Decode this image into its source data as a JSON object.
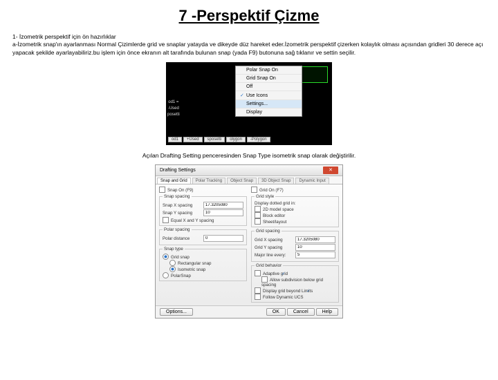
{
  "title": "7 -Perspektif Çizme",
  "para": {
    "line1": "1- İzometrik perspektif için ön hazırlıklar",
    "line2": "a-İzometrik snap'ın ayarlanması Normal Çizimlerde grid ve snaplar yatayda ve dikeyde düz hareket eder.İzometrik perspektif çizerken kolaylık olması açısından gridleri 30 derece açı yapacak şekilde ayarlayabiliriz.bu işlem için önce ekranın alt tarafında bulunan snap (yada F9) butonuna sağ tıklanır ve settin seçilir."
  },
  "ctx_menu": {
    "i0": "Polar Snap On",
    "i1": "Grid Snap On",
    "i2": "Off",
    "i3": "Use Icons",
    "i4": "Settings...",
    "i5": "Display"
  },
  "fig1_tabs": {
    "t0": "od1",
    "t1": "+Used",
    "t2": "sposetti",
    "t3": "olygon",
    "t4": "-Polygon"
  },
  "fig1_side": {
    "s0": "od1 =",
    "s1": "-Used",
    "s2": "posetti"
  },
  "caption": "Açılan Drafting Setting penceresinden Snap Type isometrik snap olarak değiştirilir.",
  "dlg": {
    "title": "Drafting Settings",
    "tabs": {
      "t0": "Snap and Grid",
      "t1": "Polar Tracking",
      "t2": "Object Snap",
      "t3": "3D Object Snap",
      "t4": "Dynamic Input"
    },
    "snap_on": "Snap On (F9)",
    "grid_on": "Grid On (F7)",
    "grp_snap_spacing": "Snap spacing",
    "snap_x": "Snap X spacing",
    "snap_y": "Snap Y spacing",
    "snap_val": "17.3205080",
    "snap_yval": "10",
    "equal_xy": "Equal X and Y spacing",
    "grp_polar": "Polar spacing",
    "polar_d": "Polar distance",
    "polar_v": "0",
    "grp_snaptype": "Snap type",
    "rb_grid": "Grid snap",
    "rb_rect": "Rectangular snap",
    "rb_iso": "Isometric snap",
    "rb_polar": "PolarSnap",
    "grp_gridstyle": "Grid style",
    "gs_lbl": "Display dotted grid in:",
    "gs1": "2D model space",
    "gs2": "Block editor",
    "gs3": "Sheet/layout",
    "grp_gridspacing": "Grid spacing",
    "gx": "Grid X spacing",
    "gy": "Grid Y spacing",
    "gxv": "17.3205080",
    "gyv": "10",
    "major": "Major line every:",
    "majorv": "5",
    "grp_gb": "Grid behavior",
    "gb1": "Adaptive grid",
    "gb2": "Allow subdivision below grid spacing",
    "gb3": "Display grid beyond Limits",
    "gb4": "Follow Dynamic UCS",
    "foot": {
      "opt": "Options...",
      "ok": "OK",
      "cancel": "Cancel",
      "help": "Help"
    }
  }
}
